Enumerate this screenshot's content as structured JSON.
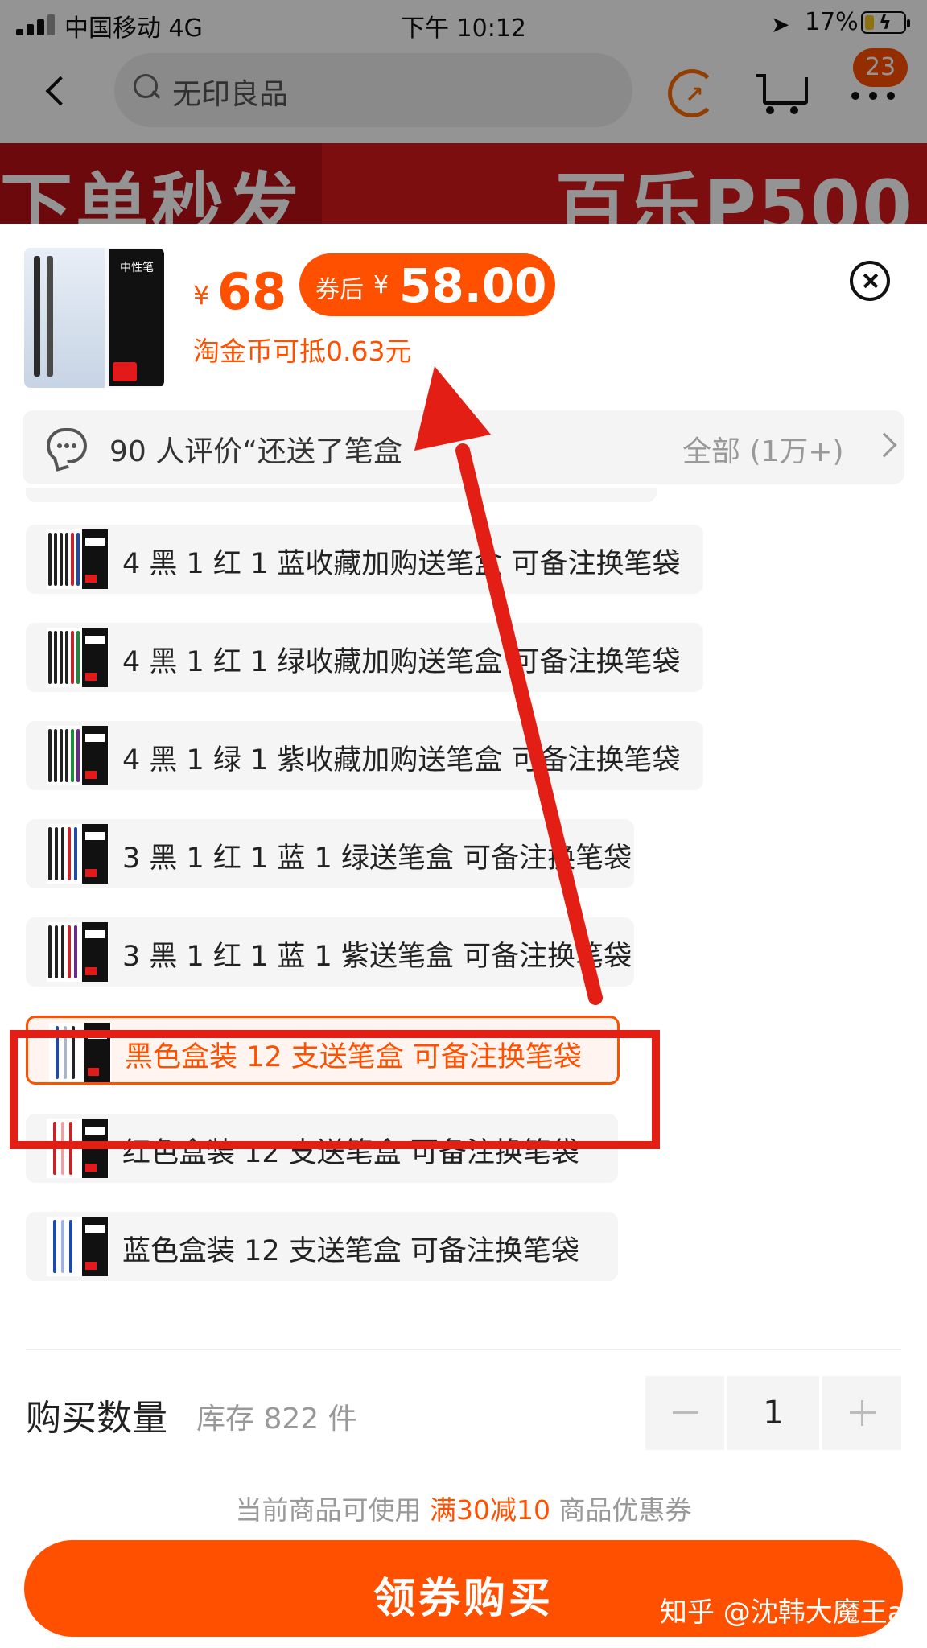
{
  "status_bar": {
    "carrier": "中国移动   4G",
    "time": "下午 10:12",
    "battery": "17%"
  },
  "nav": {
    "search_text": "无印良品",
    "cart_badge": "23"
  },
  "banner": {
    "left_text": "下单秒发",
    "right_text": "百乐P500"
  },
  "product": {
    "currency": "¥",
    "price": "68",
    "coupon_label": "券后",
    "coupon_currency": "¥",
    "coupon_price": "58.00",
    "gold_coin_text": "淘金币可抵0.63元",
    "thumb_label": "中性笔"
  },
  "review": {
    "text": "90 人评价“还送了笔盒",
    "all": "全部 (1万+)"
  },
  "options": [
    {
      "label": "4 黑 1 红 1 蓝收藏加购送笔盒 可备注换笔袋",
      "selected": false
    },
    {
      "label": "4 黑 1 红 1 绿收藏加购送笔盒 可备注换笔袋",
      "selected": false
    },
    {
      "label": "4 黑 1 绿 1 紫收藏加购送笔盒 可备注换笔袋",
      "selected": false
    },
    {
      "label": "3 黑 1 红 1 蓝 1 绿送笔盒 可备注换笔袋",
      "selected": false
    },
    {
      "label": "3 黑 1 红 1 蓝 1 紫送笔盒 可备注换笔袋",
      "selected": false
    },
    {
      "label": "黑色盒装 12 支送笔盒 可备注换笔袋",
      "selected": true
    },
    {
      "label": "红色盒装 12 支送笔盒 可备注换笔袋",
      "selected": false
    },
    {
      "label": "蓝色盒装 12 支送笔盒 可备注换笔袋",
      "selected": false
    }
  ],
  "quantity": {
    "label": "购买数量",
    "stock": "库存 822 件",
    "value": "1"
  },
  "coupon_note": {
    "prefix": "当前商品可使用 ",
    "highlight": "满30减10",
    "suffix": " 商品优惠券"
  },
  "buy_button": "领券购买",
  "watermark": "知乎 @沈韩大魔王a",
  "colors": {
    "accent": "#ff5000",
    "annotation": "#e31e14"
  }
}
